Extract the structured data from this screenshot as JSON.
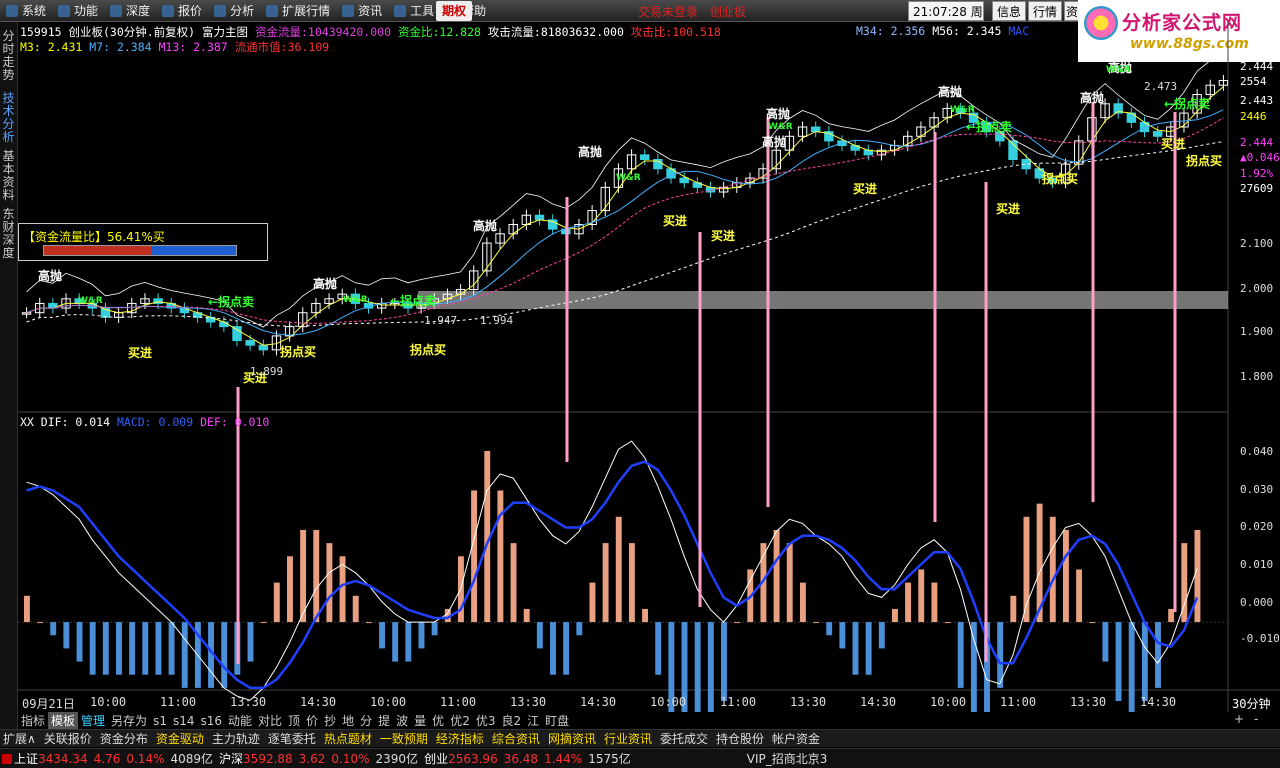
{
  "menu": [
    "系统",
    "功能",
    "深度",
    "报价",
    "分析",
    "扩展行情",
    "资讯",
    "工具",
    "帮助"
  ],
  "menu_special": "期权",
  "top_links": [
    "交易未登录",
    "创业板"
  ],
  "clock": {
    "time": "21:07:28",
    "weekday": "周二"
  },
  "top_buttons": [
    "信息",
    "行情",
    "资"
  ],
  "logo": {
    "title": "分析家公式网",
    "url": "www.88gs.com"
  },
  "left_tabs": [
    "分时走势",
    "技术分析",
    "基本资料",
    "东财深度"
  ],
  "header": {
    "code": "159915",
    "name": "创业板",
    "period": "(30分钟.前复权)",
    "chart_title": "富力主图",
    "fund_flow_label": "资金流量:",
    "fund_flow_value": "10439420.000",
    "fund_ratio_label": "资金比:",
    "fund_ratio_value": "12.828",
    "attack_flow_label": "攻击流量:",
    "attack_flow_value": "81803632.000",
    "attack_ratio_label": "攻击比:",
    "attack_ratio_value": "100.518"
  },
  "ma_line": {
    "m3": "M3: 2.431",
    "m7": "M7: 2.384",
    "m13": "M13: 2.387",
    "circ_label": "流通市值:",
    "circ_value": "36.109",
    "m34": "M34: 2.356",
    "m56": "M56: 2.345",
    "extra": "MAC"
  },
  "fund_box": {
    "label": "【资金流量比】",
    "value": "56.41%买",
    "ratio": 0.5641
  },
  "macd_header": {
    "name": "XX",
    "dif": "DIF: 0.014",
    "macd": "MACD: 0.009",
    "dea": "DEF: 0.010"
  },
  "price_axis": [
    "2.444",
    "2554",
    "2.443",
    "2446",
    "2.444",
    "▲0.046",
    "1.92%",
    "27609",
    "2.100",
    "2.000",
    "1.900",
    "1.800"
  ],
  "indicator_axis": [
    "0.040",
    "0.030",
    "0.020",
    "0.010",
    "0.000",
    "-0.010"
  ],
  "time_axis": [
    "09月21日",
    "10:00",
    "11:00",
    "13:30",
    "14:30",
    "10:00",
    "11:00",
    "13:30",
    "14:30",
    "10:00",
    "11:00",
    "13:30",
    "14:30",
    "10:00",
    "11:00",
    "13:30",
    "14:30",
    "10:00",
    "11:00",
    "13:30",
    "14:30"
  ],
  "period_label": "30分钟",
  "price_notes": [
    "1.947",
    "1.994",
    "1.899",
    "2.473"
  ],
  "signals": {
    "high": "高抛",
    "buy": "买进",
    "turn_sell": "←拐点卖",
    "turn_buy": "拐点买",
    "wr": "W&R"
  },
  "bottom_tabs": [
    "指标",
    "模板",
    "管理",
    "另存为",
    "s1",
    "s14",
    "s16",
    "动能",
    "对比",
    "顶",
    "价",
    "抄",
    "地",
    "分",
    "提",
    "波",
    "量",
    "优",
    "优2",
    "优3",
    "良2",
    "江",
    "盯盘"
  ],
  "bottom_tab_selected": "模板",
  "bottom_right": [
    "+",
    "-"
  ],
  "func_tabs": [
    "扩展∧",
    "关联报价",
    "资金分布",
    "资金驱动",
    "主力轨迹",
    "逐笔委托",
    "热点题材",
    "一致预期",
    "经济指标",
    "综合资讯",
    "网摘资讯",
    "行业资讯",
    "委托成交",
    "持仓股份",
    "帐户资金"
  ],
  "func_tabs_yellow": [
    "资金驱动",
    "热点题材",
    "一致预期",
    "经济指标",
    "综合资讯",
    "网摘资讯",
    "行业资讯"
  ],
  "status": {
    "sh_label": "上证",
    "sh_value": "3434.34",
    "sh_change": "4.76",
    "sh_pct": "0.14%",
    "sh_amount": "4089亿",
    "hs_label": "沪深",
    "hs_value": "3592.88",
    "hs_change": "3.62",
    "hs_pct": "0.10%",
    "hs_amount": "2390亿",
    "cy_label": "创业",
    "cy_value": "2563.96",
    "cy_change": "36.48",
    "cy_pct": "1.44%",
    "cy_amount": "1575亿",
    "server": "VIP_招商北京3"
  },
  "chart_data": {
    "type": "candlestick+macd",
    "price_range": [
      1.77,
      2.47
    ],
    "macd_range": [
      -0.017,
      0.045
    ],
    "close": [
      1.93,
      1.95,
      1.94,
      1.96,
      1.95,
      1.94,
      1.92,
      1.93,
      1.95,
      1.96,
      1.95,
      1.94,
      1.93,
      1.92,
      1.91,
      1.9,
      1.87,
      1.86,
      1.85,
      1.88,
      1.9,
      1.93,
      1.95,
      1.96,
      1.97,
      1.95,
      1.94,
      1.95,
      1.95,
      1.94,
      1.95,
      1.96,
      1.97,
      1.98,
      2.02,
      2.08,
      2.1,
      2.12,
      2.14,
      2.13,
      2.11,
      2.1,
      2.12,
      2.15,
      2.2,
      2.24,
      2.27,
      2.26,
      2.24,
      2.22,
      2.21,
      2.2,
      2.19,
      2.2,
      2.21,
      2.22,
      2.24,
      2.28,
      2.31,
      2.33,
      2.32,
      2.3,
      2.29,
      2.28,
      2.27,
      2.28,
      2.29,
      2.31,
      2.33,
      2.35,
      2.37,
      2.36,
      2.34,
      2.32,
      2.3,
      2.26,
      2.24,
      2.22,
      2.21,
      2.25,
      2.3,
      2.35,
      2.38,
      2.36,
      2.34,
      2.32,
      2.31,
      2.33,
      2.36,
      2.4,
      2.42,
      2.43
    ],
    "dif": [
      0.034,
      0.033,
      0.031,
      0.028,
      0.025,
      0.02,
      0.016,
      0.012,
      0.009,
      0.006,
      0.003,
      0.0,
      -0.004,
      -0.008,
      -0.012,
      -0.016,
      -0.018,
      -0.019,
      -0.016,
      -0.011,
      -0.005,
      0.002,
      0.008,
      0.012,
      0.014,
      0.012,
      0.009,
      0.005,
      0.002,
      0.0,
      0.0,
      0.0,
      0.002,
      0.008,
      0.02,
      0.032,
      0.036,
      0.035,
      0.03,
      0.025,
      0.021,
      0.019,
      0.022,
      0.028,
      0.035,
      0.042,
      0.044,
      0.04,
      0.033,
      0.025,
      0.016,
      0.008,
      0.003,
      0.0,
      0.004,
      0.01,
      0.016,
      0.022,
      0.025,
      0.024,
      0.021,
      0.019,
      0.016,
      0.011,
      0.007,
      0.006,
      0.009,
      0.014,
      0.018,
      0.02,
      0.017,
      0.008,
      -0.004,
      -0.014,
      -0.015,
      -0.008,
      0.004,
      0.012,
      0.018,
      0.023,
      0.024,
      0.021,
      0.016,
      0.008,
      0.0,
      -0.006,
      -0.01,
      -0.005,
      0.004,
      0.013
    ],
    "dea": [
      0.032,
      0.033,
      0.032,
      0.03,
      0.028,
      0.024,
      0.02,
      0.016,
      0.013,
      0.01,
      0.007,
      0.004,
      0.001,
      -0.003,
      -0.007,
      -0.011,
      -0.014,
      -0.016,
      -0.016,
      -0.014,
      -0.01,
      -0.005,
      0.001,
      0.006,
      0.009,
      0.01,
      0.009,
      0.007,
      0.005,
      0.003,
      0.002,
      0.001,
      0.001,
      0.003,
      0.01,
      0.019,
      0.026,
      0.029,
      0.029,
      0.027,
      0.025,
      0.023,
      0.023,
      0.025,
      0.029,
      0.034,
      0.038,
      0.039,
      0.037,
      0.032,
      0.026,
      0.019,
      0.012,
      0.006,
      0.004,
      0.006,
      0.01,
      0.015,
      0.019,
      0.021,
      0.021,
      0.02,
      0.018,
      0.015,
      0.011,
      0.008,
      0.008,
      0.011,
      0.014,
      0.017,
      0.017,
      0.013,
      0.005,
      -0.004,
      -0.01,
      -0.01,
      -0.004,
      0.003,
      0.01,
      0.016,
      0.02,
      0.021,
      0.019,
      0.014,
      0.007,
      0.0,
      -0.005,
      -0.006,
      -0.002,
      0.006
    ]
  }
}
